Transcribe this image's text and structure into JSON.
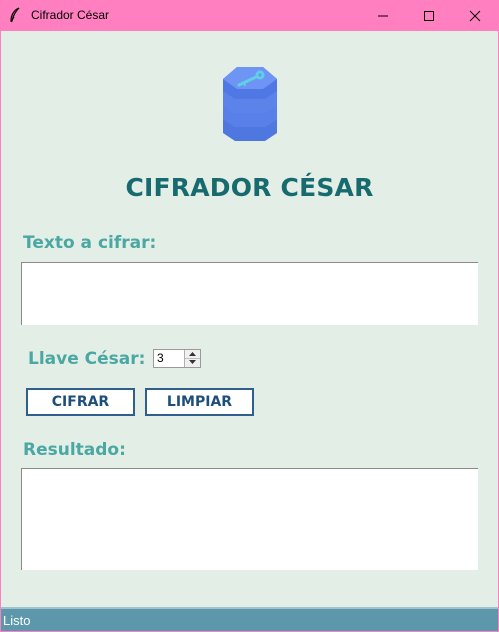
{
  "window": {
    "title": "Cifrador César",
    "controls": [
      "minimize-icon",
      "maximize-icon",
      "close-icon"
    ]
  },
  "app": {
    "logo_icon": "stacked-coins-key-icon",
    "heading": "CIFRADOR CÉSAR",
    "input_label": "Texto a cifrar:",
    "input_value": "",
    "key_label": "Llave César:",
    "key_value": "3",
    "cifrar_button": "CIFRAR",
    "limpiar_button": "LIMPIAR",
    "result_label": "Resultado:",
    "result_value": ""
  },
  "status": {
    "text": "Listo"
  },
  "colors": {
    "titlebar": "#ff7fc0",
    "background": "#e3eee6",
    "heading": "#176b6e",
    "labels": "#4aa7a2",
    "button_border": "#2f5f8c",
    "statusbar": "#5c97ab"
  }
}
